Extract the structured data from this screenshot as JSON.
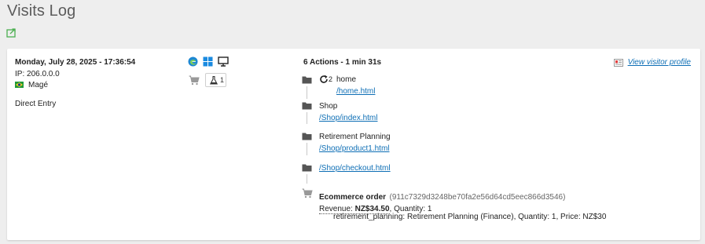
{
  "page": {
    "title": "Visits Log"
  },
  "visit": {
    "datetime": "Monday, July 28, 2025 - 17:36:54",
    "ip": "IP: 206.0.0.0",
    "city": "Magé",
    "referrer": "Direct Entry",
    "ecommerce_count": "1",
    "actions_summary": "6 Actions - 1 min 31s",
    "profile_link": "View visitor profile",
    "actions": [
      {
        "title": "home",
        "reload_count": "2",
        "url": "/home.html"
      },
      {
        "title": "Shop",
        "url": "/Shop/index.html"
      },
      {
        "title": "Retirement Planning",
        "url": "/Shop/product1.html"
      },
      {
        "title": "",
        "url": "/Shop/checkout.html"
      }
    ],
    "order": {
      "title": "Ecommerce order",
      "hash": "(911c7329d3248be70fa2e56d64cd5eec866d3546)",
      "revenue_label": "Revenue:",
      "revenue_value": "NZ$34.50",
      "quantity": ", Quantity: 1",
      "item": "retirement_planning: Retirement Planning (Finance), Quantity: 1, Price: NZ$30"
    }
  },
  "icons": {
    "export": "export-icon",
    "flag": "brazil-flag-icon",
    "browser": "edge-browser-icon",
    "os": "windows-icon",
    "device": "desktop-icon",
    "cart": "cart-icon",
    "flask": "flask-icon",
    "folder": "folder-icon",
    "reload": "reload-icon",
    "profile": "visitor-profile-icon"
  },
  "colors": {
    "link": "#0d6eb5",
    "edge": "#1e88d2",
    "windows": "#1a8ae0",
    "brazil_green": "#1f9a3a",
    "brazil_yellow": "#f6d21e"
  }
}
